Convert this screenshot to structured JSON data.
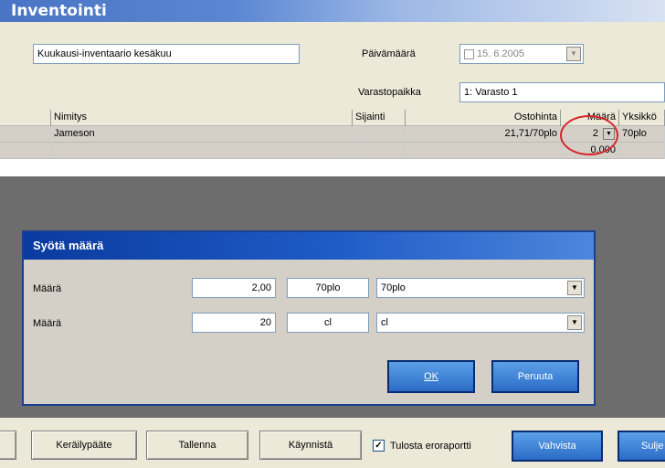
{
  "window": {
    "title": "Inventointi"
  },
  "form": {
    "name_value": "Kuukausi-inventaario kesäkuu",
    "date_label": "Päivämäärä",
    "date_value": "15. 6.2005",
    "location_label": "Varastopaikka",
    "location_value": "1: Varasto 1"
  },
  "grid": {
    "columns": [
      "Nimitys",
      "Sijainti",
      "Ostohinta",
      "Määrä",
      "Yksikkö"
    ],
    "rows": [
      {
        "name": "Jameson",
        "location": "",
        "price": "21,71/70plo",
        "qty": "2",
        "unit": "70plo"
      },
      {
        "name": "",
        "location": "",
        "price": "",
        "qty": "0,000",
        "unit": ""
      }
    ]
  },
  "dialog": {
    "title": "Syötä määrä",
    "rows": [
      {
        "label": "Määrä",
        "value": "2,00",
        "unit": "70plo",
        "unit_select": "70plo"
      },
      {
        "label": "Määrä",
        "value": "20",
        "unit": "cl",
        "unit_select": "cl"
      }
    ],
    "ok_label": "OK",
    "cancel_label": "Peruuta"
  },
  "toolbar": {
    "collector_label": "Keräilypääte",
    "save_label": "Tallenna",
    "start_label": "Käynnistä",
    "print_diff_label": "Tulosta eroraportti",
    "print_diff_checked": true,
    "confirm_label": "Vahvista",
    "close_label": "Sulje"
  },
  "colors": {
    "accent": "#2a6cc6",
    "title_gradient_start": "#4a74c4",
    "highlight": "#d8242a"
  }
}
